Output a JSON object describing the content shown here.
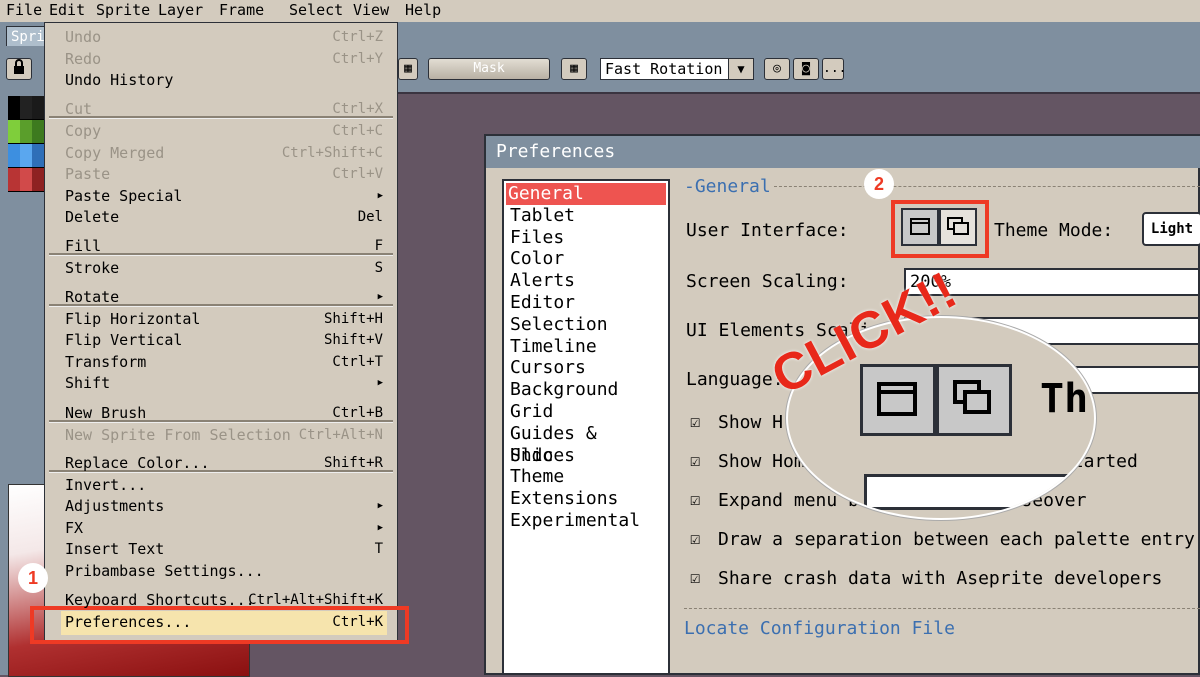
{
  "menubar": [
    "File",
    "Edit",
    "Sprite",
    "Layer",
    "Frame",
    "Select",
    "View",
    "Help"
  ],
  "tab": {
    "label": "Sprit"
  },
  "toolbar": {
    "mask_label": "Mask",
    "rotation_value": "Fast Rotation",
    "more_label": "..."
  },
  "edit_menu": {
    "items": [
      {
        "label": "Undo",
        "shortcut": "Ctrl+Z",
        "disabled": true
      },
      {
        "label": "Redo",
        "shortcut": "Ctrl+Y",
        "disabled": true
      },
      {
        "label": "Undo History",
        "shortcut": "",
        "disabled": false
      },
      {
        "label": "Cut",
        "shortcut": "Ctrl+X",
        "disabled": true
      },
      {
        "label": "Copy",
        "shortcut": "Ctrl+C",
        "disabled": true
      },
      {
        "label": "Copy Merged",
        "shortcut": "Ctrl+Shift+C",
        "disabled": true
      },
      {
        "label": "Paste",
        "shortcut": "Ctrl+V",
        "disabled": true
      },
      {
        "label": "Paste Special",
        "shortcut": "",
        "submenu": true
      },
      {
        "label": "Delete",
        "shortcut": "Del"
      },
      {
        "label": "Fill",
        "shortcut": "F"
      },
      {
        "label": "Stroke",
        "shortcut": "S"
      },
      {
        "label": "Rotate",
        "shortcut": "",
        "submenu": true
      },
      {
        "label": "Flip Horizontal",
        "shortcut": "Shift+H"
      },
      {
        "label": "Flip Vertical",
        "shortcut": "Shift+V"
      },
      {
        "label": "Transform",
        "shortcut": "Ctrl+T"
      },
      {
        "label": "Shift",
        "shortcut": "",
        "submenu": true
      },
      {
        "label": "New Brush",
        "shortcut": "Ctrl+B"
      },
      {
        "label": "New Sprite From Selection",
        "shortcut": "Ctrl+Alt+N",
        "disabled": true
      },
      {
        "label": "Replace Color...",
        "shortcut": "Shift+R"
      },
      {
        "label": "Invert...",
        "shortcut": ""
      },
      {
        "label": "Adjustments",
        "shortcut": "",
        "submenu": true
      },
      {
        "label": "FX",
        "shortcut": "",
        "submenu": true
      },
      {
        "label": "Insert Text",
        "shortcut": "T"
      },
      {
        "label": "Pribambase Settings...",
        "shortcut": ""
      },
      {
        "label": "Keyboard Shortcuts...",
        "shortcut": "Ctrl+Alt+Shift+K"
      },
      {
        "label": "Preferences...",
        "shortcut": "Ctrl+K"
      }
    ]
  },
  "preferences": {
    "title": "Preferences",
    "categories": [
      "General",
      "Tablet",
      "Files",
      "Color",
      "Alerts",
      "Editor",
      "Selection",
      "Timeline",
      "Cursors",
      "Background",
      "Grid",
      "Guides & Slices",
      "Undo",
      "Theme",
      "Extensions",
      "Experimental"
    ],
    "selected_category": "General",
    "section_title": "General",
    "user_interface_label": "User Interface:",
    "theme_mode_label": "Theme Mode:",
    "theme_mode_value": "Light",
    "screen_scaling_label": "Screen Scaling:",
    "screen_scaling_value": "200%",
    "ui_scaling_label": "UI Elements Scaling:",
    "language_label": "Language:",
    "checkboxes": [
      "Show H",
      "Show Home",
      "Expand menu bar items on mouseover",
      "Draw a separation between each palette entry",
      "Share crash data with Aseprite developers"
    ],
    "started_fragment": "started",
    "locate_label": "Locate Configuration File"
  },
  "annotations": {
    "step1": "1",
    "step2": "2",
    "click_text": "CLICK!!",
    "zoom_text": "Th"
  },
  "colors": {
    "highlight_red": "#ee3a24",
    "selected_category": "#ee5450",
    "menu_bg": "#d3cbbe",
    "toolbar_bg": "#7f8f9f"
  }
}
